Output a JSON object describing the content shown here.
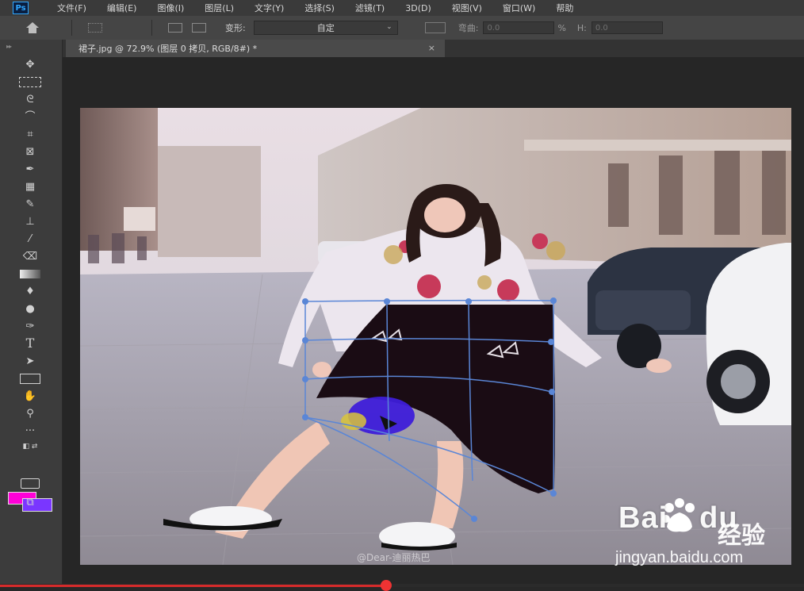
{
  "menu": {
    "logo": "Ps",
    "items": [
      "文件(F)",
      "编辑(E)",
      "图像(I)",
      "图层(L)",
      "文字(Y)",
      "选择(S)",
      "滤镜(T)",
      "3D(D)",
      "视图(V)",
      "窗口(W)",
      "帮助"
    ]
  },
  "options": {
    "deform_label": "变形:",
    "deform_value": "自定",
    "bend_label": "弯曲:",
    "bend_value": "0.0",
    "percent": "%",
    "h_label": "H:",
    "h_value": "0.0"
  },
  "document": {
    "tab_title": "裙子.jpg @ 72.9% (图层 0 拷贝, RGB/8#) *",
    "close": "×"
  },
  "colors": {
    "foreground": "#ff00d8",
    "background": "#7a36ff",
    "skirt": "#1a0c14",
    "mesh": "#5a86d6"
  },
  "watermark": {
    "logo": "Bai",
    "logo2": "du",
    "cn": "经验",
    "url": "jingyan.baidu.com",
    "credit": "@Dear-迪丽热巴"
  },
  "tools": [
    "move-tool",
    "marquee-tool",
    "lasso-tool",
    "quick-select-tool",
    "crop-tool",
    "frame-tool",
    "eyedropper-tool",
    "healing-tool",
    "brush-tool",
    "stamp-tool",
    "history-brush-tool",
    "eraser-tool",
    "gradient-tool",
    "blur-tool",
    "dodge-tool",
    "pen-tool",
    "type-tool",
    "path-select-tool",
    "rectangle-tool",
    "hand-tool",
    "zoom-tool",
    "more-tools"
  ],
  "video": {
    "progress": 0.48
  }
}
